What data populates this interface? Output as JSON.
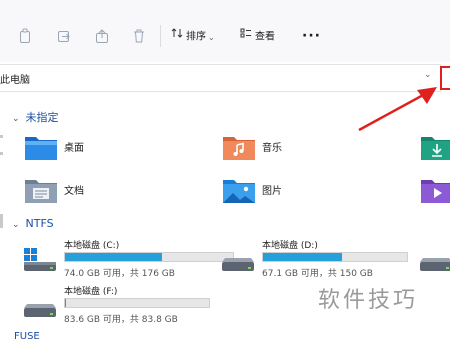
{
  "toolbar": {
    "icons": [
      "copy-icon",
      "paste-icon",
      "share-icon",
      "delete-icon"
    ],
    "sort_label": "排序",
    "view_label": "查看",
    "more_label": "···"
  },
  "address_bar": {
    "path": "此电脑"
  },
  "sections": {
    "quick_access": {
      "title": "未指定",
      "items": [
        {
          "label": "桌面",
          "icon": "desktop-folder-icon"
        },
        {
          "label": "音乐",
          "icon": "music-folder-icon"
        },
        {
          "label": "",
          "icon": "downloads-folder-icon"
        },
        {
          "label": "文档",
          "icon": "documents-folder-icon"
        },
        {
          "label": "图片",
          "icon": "pictures-folder-icon"
        },
        {
          "label": "",
          "icon": "videos-folder-icon"
        }
      ]
    },
    "ntfs": {
      "title": "NTFS",
      "drives": [
        {
          "name": "本地磁盘 (C:)",
          "free_text": "74.0 GB 可用，共 176 GB",
          "used_fraction": 0.58
        },
        {
          "name": "本地磁盘 (D:)",
          "free_text": "67.1 GB 可用，共 150 GB",
          "used_fraction": 0.55
        },
        {
          "name": "本地磁盘 (F:)",
          "free_text": "83.6 GB 可用，共 83.8 GB",
          "used_fraction": 0.01
        }
      ]
    },
    "next_section_partial": "FUSE"
  },
  "colors": {
    "accent": "#1a4fa3",
    "drive_fill": "#26a0da",
    "highlight": "#e0201e"
  },
  "watermark": "软件技巧"
}
